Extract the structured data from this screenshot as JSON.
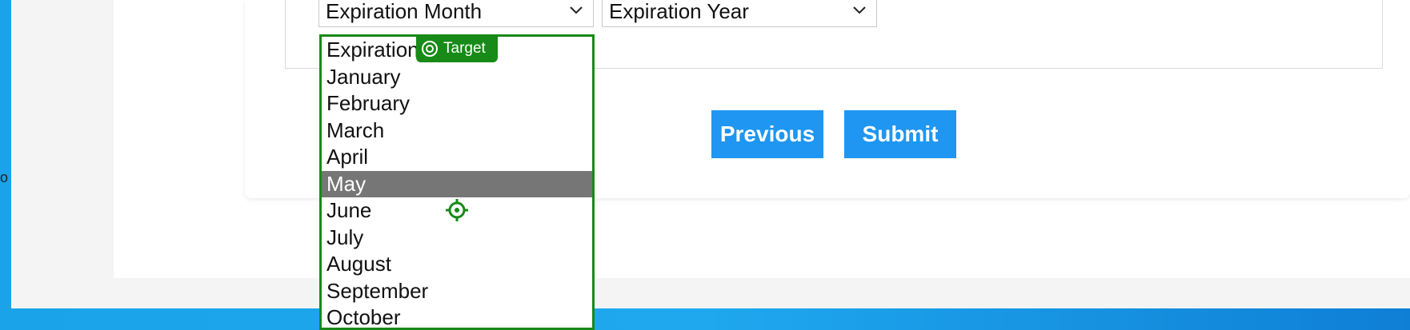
{
  "form": {
    "month_select": {
      "value": "Expiration Month"
    },
    "year_select": {
      "value": "Expiration Year"
    }
  },
  "month_options": [
    {
      "label": "Expiration Month",
      "selected": false
    },
    {
      "label": "January",
      "selected": false
    },
    {
      "label": "February",
      "selected": false
    },
    {
      "label": "March",
      "selected": false
    },
    {
      "label": "April",
      "selected": false
    },
    {
      "label": "May",
      "selected": true
    },
    {
      "label": "June",
      "selected": false
    },
    {
      "label": "July",
      "selected": false
    },
    {
      "label": "August",
      "selected": false
    },
    {
      "label": "September",
      "selected": false
    },
    {
      "label": "October",
      "selected": false
    }
  ],
  "overlay": {
    "target_label": "Target"
  },
  "buttons": {
    "previous": "Previous",
    "submit": "Submit"
  },
  "left_edge_glyph": "o",
  "colors": {
    "accent": "#1e96f2",
    "target": "#178a17",
    "selected_option": "#767676"
  }
}
